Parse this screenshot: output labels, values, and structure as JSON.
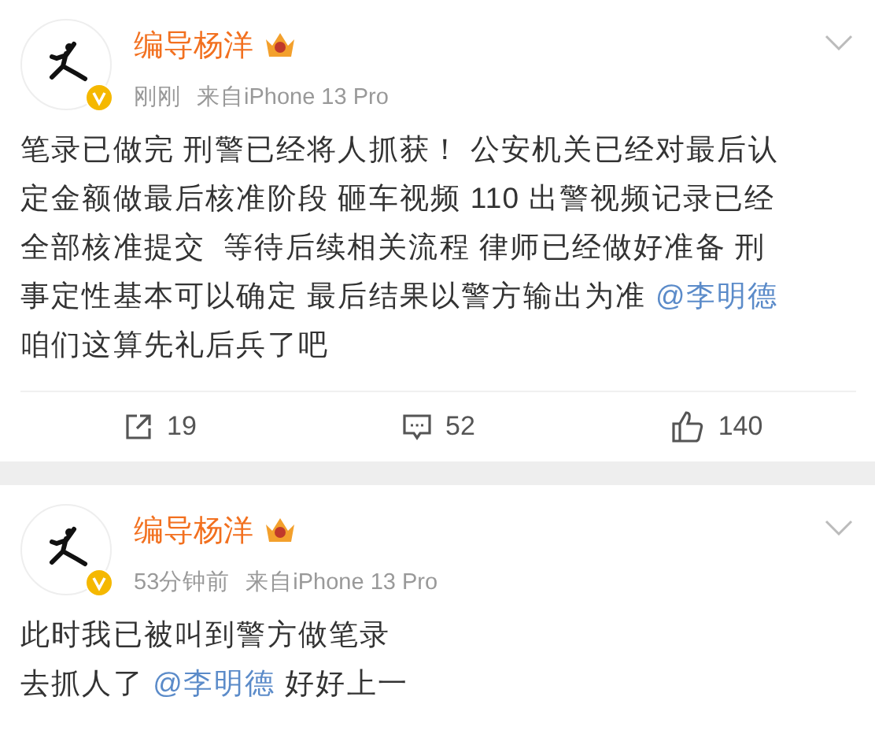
{
  "posts": [
    {
      "author": "编导杨洋",
      "time": "刚刚",
      "source": "来自iPhone 13 Pro",
      "body": [
        {
          "kind": "text",
          "text": "笔录已做完 刑警已经将人抓获！ 公安机关已经对最后认"
        },
        {
          "kind": "break"
        },
        {
          "kind": "text",
          "text": "定金额做最后核准阶段 砸车视频 110 出警视频记录已经"
        },
        {
          "kind": "break"
        },
        {
          "kind": "text",
          "text": "全部核准提交  等待后续相关流程 律师已经做好准备 刑"
        },
        {
          "kind": "break"
        },
        {
          "kind": "text",
          "text": "事定性基本可以确定 最后结果以警方输出为准 "
        },
        {
          "kind": "mention",
          "text": "@李明德"
        },
        {
          "kind": "break"
        },
        {
          "kind": "text",
          "text": "咱们这算先礼后兵了吧"
        }
      ],
      "actions": [
        {
          "kind": "repost",
          "count": "19"
        },
        {
          "kind": "comment",
          "count": "52"
        },
        {
          "kind": "like",
          "count": "140"
        }
      ]
    },
    {
      "author": "编导杨洋",
      "time": "53分钟前",
      "source": "来自iPhone 13 Pro",
      "body": [
        {
          "kind": "text",
          "text": "此时我已被叫到警方做笔录"
        },
        {
          "kind": "break"
        },
        {
          "kind": "text",
          "text": "去抓人了 "
        },
        {
          "kind": "mention",
          "text": "@李明德"
        },
        {
          "kind": "text",
          "text": " 好好上一"
        }
      ]
    }
  ]
}
